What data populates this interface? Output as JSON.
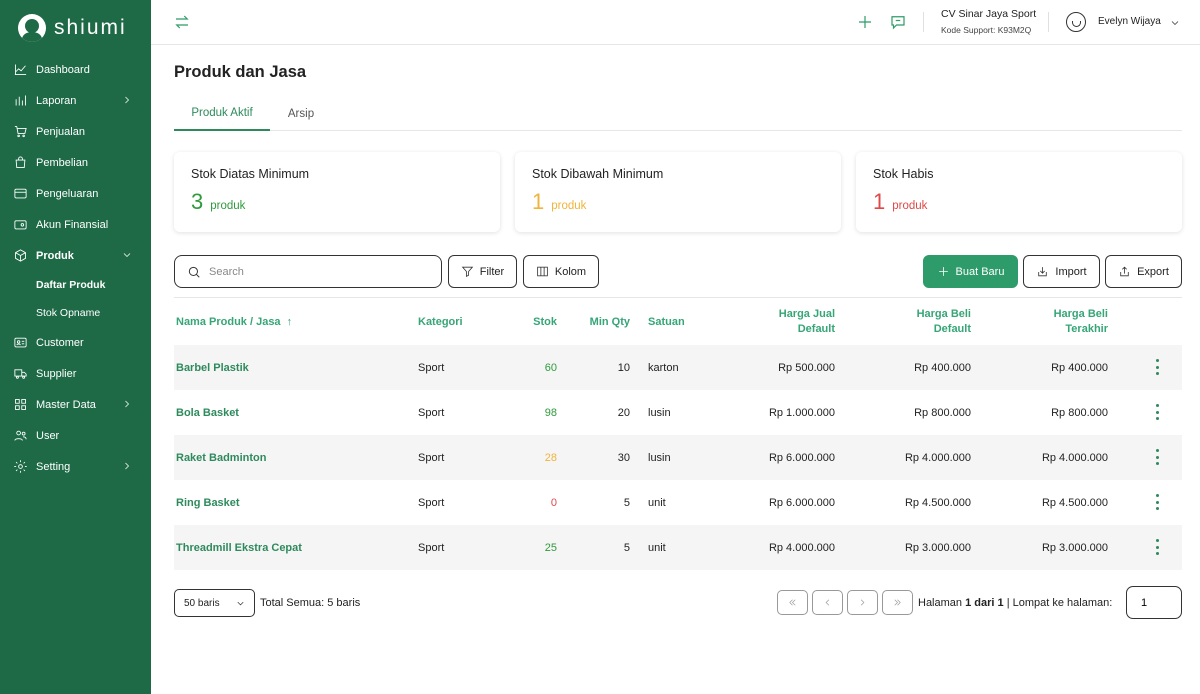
{
  "brand": {
    "name": "shiumi"
  },
  "sidebar": {
    "items": [
      {
        "label": "Dashboard",
        "icon": "chart-line-icon",
        "has_chevron": false
      },
      {
        "label": "Laporan",
        "icon": "bar-chart-icon",
        "has_chevron": true
      },
      {
        "label": "Penjualan",
        "icon": "cart-icon",
        "has_chevron": false
      },
      {
        "label": "Pembelian",
        "icon": "shopping-bag-icon",
        "has_chevron": false
      },
      {
        "label": "Pengeluaran",
        "icon": "credit-card-icon",
        "has_chevron": false
      },
      {
        "label": "Akun Finansial",
        "icon": "wallet-icon",
        "has_chevron": false
      },
      {
        "label": "Produk",
        "icon": "box-icon",
        "has_chevron": true,
        "expanded": true,
        "active": true
      },
      {
        "label": "Customer",
        "icon": "contact-card-icon",
        "has_chevron": false
      },
      {
        "label": "Supplier",
        "icon": "truck-icon",
        "has_chevron": false
      },
      {
        "label": "Master Data",
        "icon": "grid-icon",
        "has_chevron": true
      },
      {
        "label": "User",
        "icon": "users-icon",
        "has_chevron": false
      },
      {
        "label": "Setting",
        "icon": "gear-icon",
        "has_chevron": true
      }
    ],
    "produk_sub": [
      {
        "label": "Daftar Produk",
        "active": true
      },
      {
        "label": "Stok Opname",
        "active": false
      }
    ]
  },
  "header": {
    "company_name": "CV Sinar Jaya Sport",
    "support_code": "Kode Support: K93M2Q",
    "user_name": "Evelyn Wijaya"
  },
  "page": {
    "title": "Produk dan Jasa",
    "tabs": [
      {
        "label": "Produk Aktif",
        "active": true
      },
      {
        "label": "Arsip",
        "active": false
      }
    ]
  },
  "stats": [
    {
      "title": "Stok Diatas Minimum",
      "value": "3",
      "unit": "produk",
      "color": "#2e9b3c"
    },
    {
      "title": "Stok Dibawah Minimum",
      "value": "1",
      "unit": "produk",
      "color": "#f0b43c"
    },
    {
      "title": "Stok Habis",
      "value": "1",
      "unit": "produk",
      "color": "#e04848"
    }
  ],
  "toolbar": {
    "search_placeholder": "Search",
    "filter_label": "Filter",
    "kolom_label": "Kolom",
    "create_label": "Buat Baru",
    "import_label": "Import",
    "export_label": "Export"
  },
  "table": {
    "columns": {
      "name": "Nama Produk / Jasa",
      "sort_arrow": "↑",
      "category": "Kategori",
      "stock": "Stok",
      "min_qty": "Min Qty",
      "unit": "Satuan",
      "sell_line1": "Harga Jual",
      "sell_line2": "Default",
      "buy_line1": "Harga Beli",
      "buy_line2": "Default",
      "last_line1": "Harga Beli",
      "last_line2": "Terakhir"
    },
    "rows": [
      {
        "name": "Barbel Plastik",
        "category": "Sport",
        "stock": "60",
        "stock_color": "#2e9b3c",
        "min_qty": "10",
        "unit": "karton",
        "sell": "Rp 500.000",
        "buy": "Rp 400.000",
        "last": "Rp 400.000"
      },
      {
        "name": "Bola Basket",
        "category": "Sport",
        "stock": "98",
        "stock_color": "#2e9b3c",
        "min_qty": "20",
        "unit": "lusin",
        "sell": "Rp 1.000.000",
        "buy": "Rp 800.000",
        "last": "Rp 800.000"
      },
      {
        "name": "Raket Badminton",
        "category": "Sport",
        "stock": "28",
        "stock_color": "#f0b43c",
        "min_qty": "30",
        "unit": "lusin",
        "sell": "Rp 6.000.000",
        "buy": "Rp 4.000.000",
        "last": "Rp 4.000.000"
      },
      {
        "name": "Ring Basket",
        "category": "Sport",
        "stock": "0",
        "stock_color": "#e04848",
        "min_qty": "5",
        "unit": "unit",
        "sell": "Rp 6.000.000",
        "buy": "Rp 4.500.000",
        "last": "Rp 4.500.000"
      },
      {
        "name": "Threadmill Ekstra Cepat",
        "category": "Sport",
        "stock": "25",
        "stock_color": "#2e9b3c",
        "min_qty": "5",
        "unit": "unit",
        "sell": "Rp 4.000.000",
        "buy": "Rp 3.000.000",
        "last": "Rp 3.000.000"
      }
    ]
  },
  "pagination": {
    "per_page": "50 baris",
    "total": "Total Semua: 5 baris",
    "page_prefix": "Halaman",
    "page_value": "1 dari 1",
    "jump_label": "|  Lompat ke halaman:",
    "jump_value": "1"
  },
  "colors": {
    "sidebar": "#1e6a47",
    "accent": "#2e9b6a",
    "link": "#2e8a5c"
  }
}
